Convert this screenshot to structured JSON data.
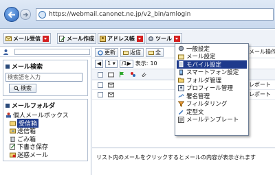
{
  "browser": {
    "url": "https://webmail.canonet.ne.jp/v2_bin/amlogin"
  },
  "top_toolbar": {
    "tabs": [
      {
        "label": "メール受信"
      },
      {
        "label": "メール作成"
      },
      {
        "label": "アドレス帳"
      },
      {
        "label": "ツール"
      }
    ],
    "partial_right": "メール操作"
  },
  "sidebar": {
    "search": {
      "title": "メール検索",
      "placeholder": "検索語を入力",
      "button": "検索"
    },
    "folders": {
      "title": "メールフォルダ",
      "root": "個人メールボックス",
      "items": [
        {
          "label": "受信箱",
          "icon": "inbox-icon"
        },
        {
          "label": "送信箱",
          "icon": "outbox-icon"
        },
        {
          "label": "ごみ箱",
          "icon": "trash-icon"
        },
        {
          "label": "下書き保存",
          "icon": "draft-icon"
        },
        {
          "label": "迷惑メール",
          "icon": "spam-icon"
        }
      ]
    }
  },
  "main": {
    "toolbar": {
      "refresh": "更新",
      "reply": "返信",
      "partial": "全"
    },
    "pager": {
      "page": "1",
      "display_label": "表示:",
      "display_value": "10"
    },
    "rows": [
      {
        "subject": "レポート"
      },
      {
        "subject": "レポート"
      }
    ],
    "preview_text": "リスト内のメールをクリックするとメールの内容が表示されます"
  },
  "tools_menu": {
    "items": [
      {
        "label": "一般設定",
        "icon": "general-settings-icon"
      },
      {
        "label": "メール設定",
        "icon": "mail-settings-icon"
      },
      {
        "label": "モバイル設定",
        "icon": "mobile-settings-icon",
        "highlighted": true
      },
      {
        "label": "スマートフォン設定",
        "icon": "smartphone-settings-icon"
      },
      {
        "label": "フォルダ管理",
        "icon": "folder-manage-icon"
      },
      {
        "label": "プロフィール管理",
        "icon": "profile-manage-icon"
      },
      {
        "label": "署名管理",
        "icon": "signature-icon"
      },
      {
        "label": "フィルタリング",
        "icon": "filter-icon"
      },
      {
        "label": "定型文",
        "icon": "template-text-icon"
      },
      {
        "label": "メールテンプレート",
        "icon": "mail-template-icon"
      }
    ]
  }
}
